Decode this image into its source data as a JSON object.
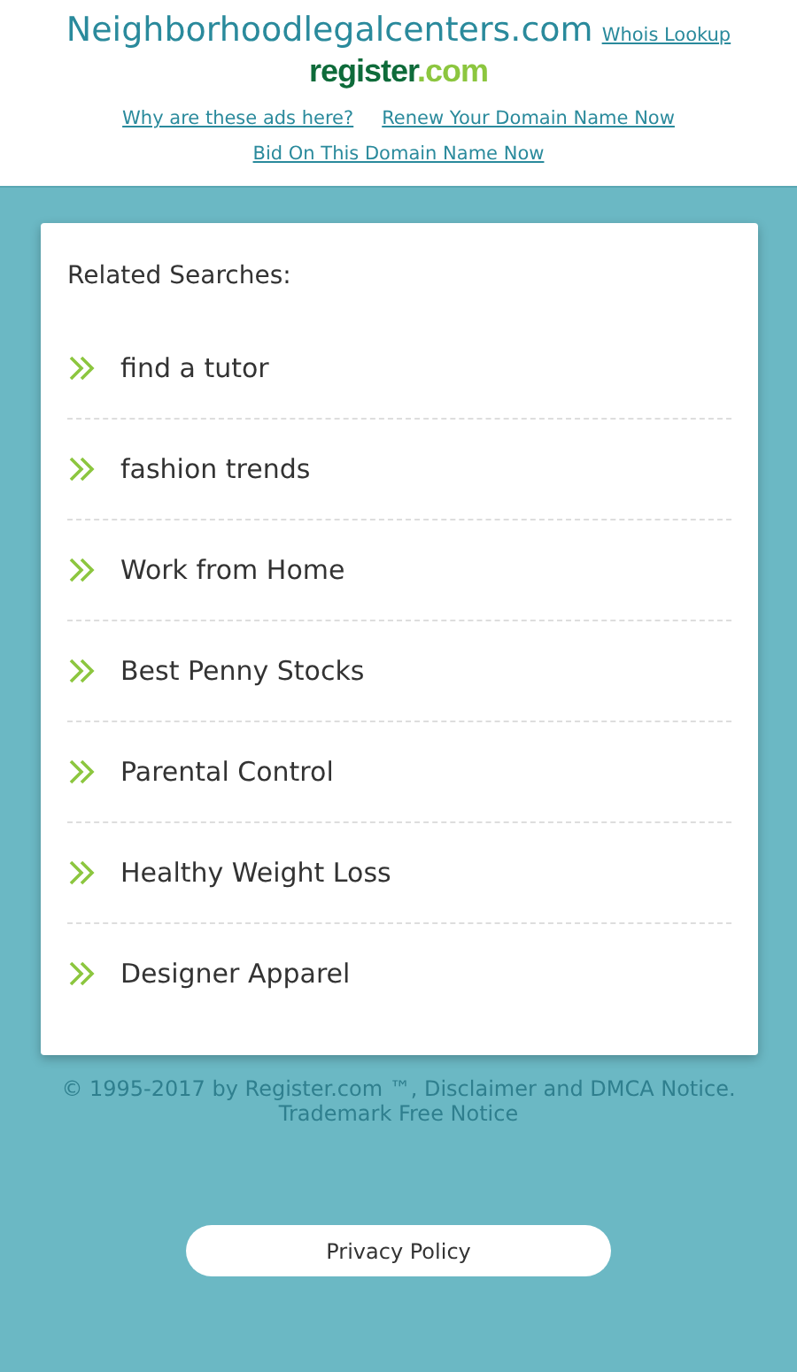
{
  "header": {
    "domain": "Neighborhoodlegalcenters.com",
    "whois_link": "Whois Lookup",
    "logo": {
      "name": "register",
      "tld": ".com"
    },
    "links": [
      "Why are these ads here?",
      "Renew Your Domain Name Now",
      "Bid On This Domain Name Now"
    ]
  },
  "related": {
    "title": "Related Searches:",
    "items": [
      "find a tutor",
      "fashion trends",
      "Work from Home",
      "Best Penny Stocks",
      "Parental Control",
      "Healthy Weight Loss",
      "Designer Apparel"
    ]
  },
  "footer": {
    "copyright": "© 1995-2017 by Register.com ™, Disclaimer and DMCA Notice.",
    "trademark": "Trademark Free Notice",
    "privacy_button": "Privacy Policy"
  }
}
